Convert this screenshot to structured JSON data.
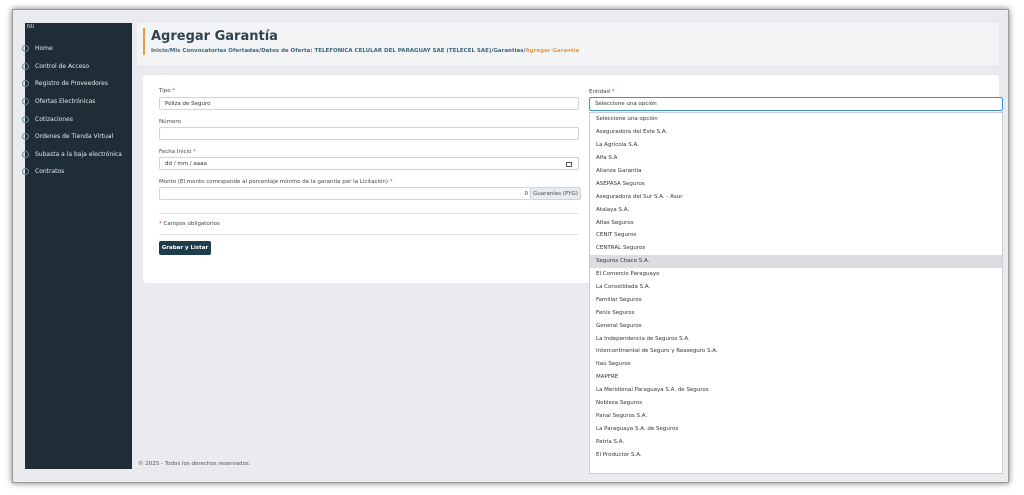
{
  "sidebar": {
    "menu_tag": "NU",
    "items": [
      {
        "label": "Home"
      },
      {
        "label": "Control de Acceso"
      },
      {
        "label": "Registro de Proveedores"
      },
      {
        "label": "Ofertas Electrónicas"
      },
      {
        "label": "Cotizaciones"
      },
      {
        "label": "Ordenes de Tienda Virtual"
      },
      {
        "label": "Subasta a la baja electrónica"
      },
      {
        "label": "Contratos"
      }
    ]
  },
  "header": {
    "title": "Agregar Garantía",
    "breadcrumb": "Inicio/Mis Convocatorias Ofertadas/Datos de Oferta: TELEFONICA CELULAR DEL PARAGUAY SAE (TELECEL SAE)/Garantias/",
    "breadcrumb_current": "Agregar Garantía"
  },
  "form": {
    "tipo_label": "Tipo",
    "tipo_value": "Póliza de Seguro",
    "numero_label": "Número",
    "numero_value": "",
    "fecha_label": "Fecha Inicio",
    "fecha_placeholder": "dd / mm / aaaa",
    "monto_label": "Monto (El monto corresponde al porcentaje mínimo de la garantía por la Licitación)",
    "monto_value": "0",
    "currency": "Guaraníes (PYG)",
    "required_asterisk": "*",
    "required_note": "Campos obligatorios",
    "submit_label": "Grabar y Listar",
    "entidad_label": "Entidad",
    "entidad_value": "Seleccione una opción"
  },
  "dropdown": {
    "selected_index": 12,
    "options": [
      "Seleccione una opción",
      "Aseguradora del Este S.A.",
      "La Agrícola S.A.",
      "Alfa S.A",
      "Alianza Garantía",
      "ASEPASA Seguros",
      "Aseguradora del Sur S.A. - Asur",
      "Atalaya S.A.",
      "Atlas Seguros",
      "CENIT Seguros",
      "CENTRAL Seguros",
      "Seguros Chaco S.A.",
      "El Comercio Paraguayo",
      "La Consolidada S.A.",
      "Familiar Seguros",
      "Fenix Seguros",
      "General Seguros",
      "La Independencia de Seguros S.A.",
      "Intercontinental de Seguro y Reaseguro S.A.",
      "Itaú Seguros",
      "MAPFRE",
      "La Meridional Paraguaya S.A. de Seguros",
      "Nobleza Seguros",
      "Panal Seguros S.A.",
      "La Paraguaya S.A. de Seguros",
      "Patria S.A.",
      "El Productor S.A."
    ]
  },
  "footer": {
    "text": "© 2025 - Todos los derechos reservados."
  }
}
